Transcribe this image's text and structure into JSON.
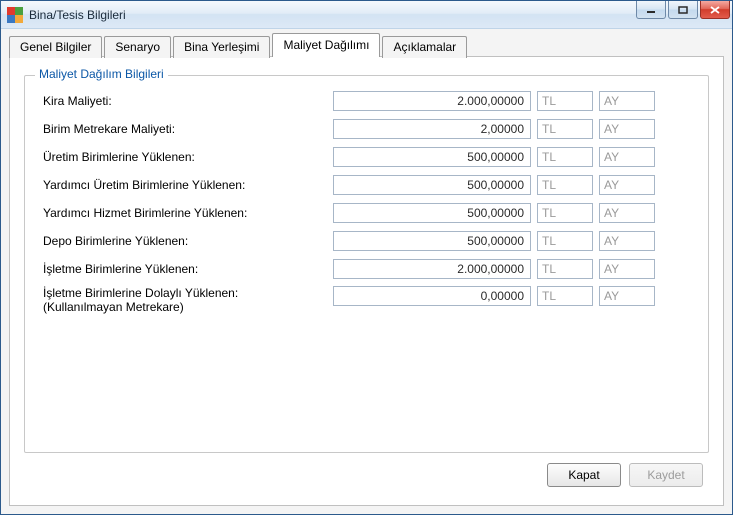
{
  "window": {
    "title": "Bina/Tesis Bilgileri"
  },
  "tabs": {
    "items": [
      "Genel Bilgiler",
      "Senaryo",
      "Bina Yerleşimi",
      "Maliyet Dağılımı",
      "Açıklamalar"
    ],
    "active_index": 3
  },
  "group": {
    "title": "Maliyet Dağılım Bilgileri"
  },
  "rows": [
    {
      "label": "Kira Maliyeti:",
      "value": "2.000,00000",
      "currency": "TL",
      "period": "AY"
    },
    {
      "label": "Birim Metrekare Maliyeti:",
      "value": "2,00000",
      "currency": "TL",
      "period": "AY"
    },
    {
      "label": "Üretim Birimlerine Yüklenen:",
      "value": "500,00000",
      "currency": "TL",
      "period": "AY"
    },
    {
      "label": "Yardımcı Üretim Birimlerine Yüklenen:",
      "value": "500,00000",
      "currency": "TL",
      "period": "AY"
    },
    {
      "label": "Yardımcı Hizmet Birimlerine Yüklenen:",
      "value": "500,00000",
      "currency": "TL",
      "period": "AY"
    },
    {
      "label": "Depo Birimlerine Yüklenen:",
      "value": "500,00000",
      "currency": "TL",
      "period": "AY"
    },
    {
      "label": "İşletme Birimlerine Yüklenen:",
      "value": "2.000,00000",
      "currency": "TL",
      "period": "AY"
    },
    {
      "label": "İşletme Birimlerine Dolaylı Yüklenen:",
      "sublabel": "(Kullanılmayan Metrekare)",
      "value": "0,00000",
      "currency": "TL",
      "period": "AY"
    }
  ],
  "footer": {
    "close": "Kapat",
    "save": "Kaydet"
  }
}
